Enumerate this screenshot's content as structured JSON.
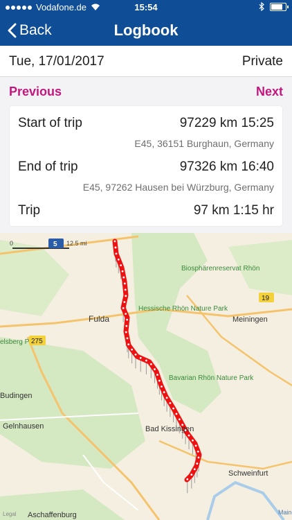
{
  "status": {
    "carrier": "Vodafone.de",
    "time": "15:54",
    "battery_level": 0.85
  },
  "nav": {
    "back_label": "Back",
    "title": "Logbook"
  },
  "date_bar": {
    "date": "Tue, 17/01/2017",
    "category": "Private"
  },
  "pager": {
    "previous": "Previous",
    "next": "Next"
  },
  "trip": {
    "start_label": "Start of trip",
    "start_value": "97229 km 15:25",
    "start_address": "E45, 36151 Burghaun, Germany",
    "end_label": "End of trip",
    "end_value": "97326 km 16:40",
    "end_address": "E45, 97262 Hausen bei Würzburg, Germany",
    "trip_label": "Trip",
    "trip_value": "97 km 1:15 hr"
  },
  "map": {
    "scale": {
      "zero": "0",
      "km": "5",
      "mi": "12.5 mi"
    },
    "route_color": "#ee1111",
    "labels": {
      "fulda": "Fulda",
      "meiningen": "Meiningen",
      "biosphere": "Biosphärenreservat Rhön",
      "rhoen_np": "Hessische Rhön Nature Park",
      "bavarian_np": "Bavarian Rhön Nature Park",
      "budingen": "Budingen",
      "gelnhausen": "Gelnhausen",
      "bad_kissingen": "Bad Kissingen",
      "schweinfurt": "Schweinfurt",
      "aschaffenburg": "Aschaffenburg",
      "vogelsberg": "elsberg Park",
      "road19": "19",
      "road275": "275",
      "main": "Main",
      "legal": "Legal"
    }
  }
}
